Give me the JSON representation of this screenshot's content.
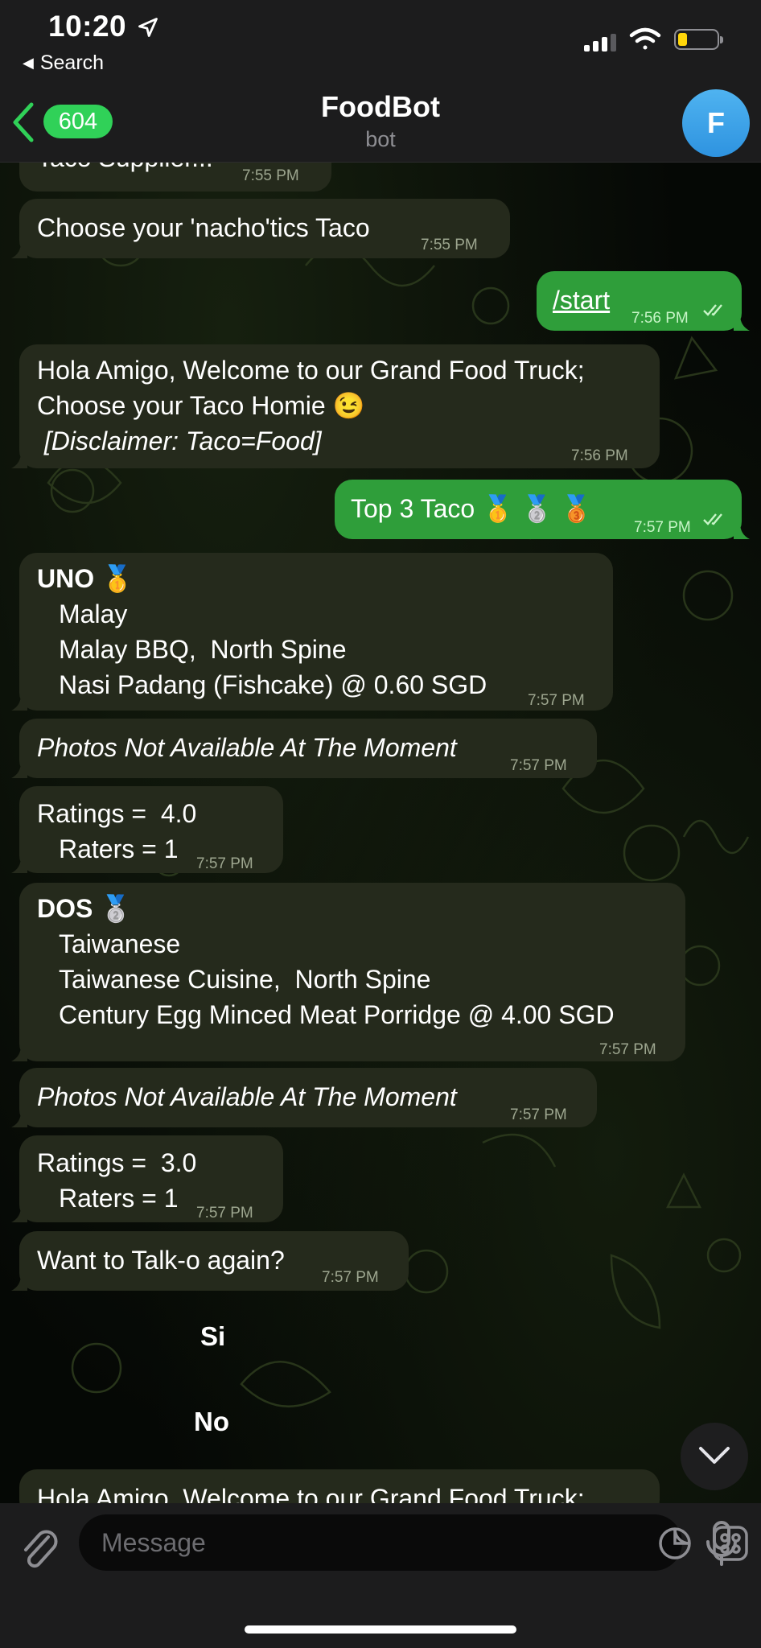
{
  "status_bar": {
    "time": "10:20",
    "back_label": "Search"
  },
  "header": {
    "back_count": "604",
    "title": "FoodBot",
    "subtitle": "bot",
    "avatar_letter": "F"
  },
  "messages": [
    {
      "lines": [
        "Taco Supplier..."
      ],
      "time": "7:55 PM"
    },
    {
      "lines": [
        "Choose your 'nacho'tics Taco"
      ],
      "time": "7:55 PM"
    },
    {
      "lines": [
        "/start"
      ],
      "time": "7:56 PM"
    },
    {
      "lines": [
        "Hola Amigo, Welcome to our Grand Food Truck;",
        "Choose your Taco Homie 😉",
        " [Disclaimer: Taco=Food]"
      ],
      "time": "7:56 PM"
    },
    {
      "lines": [
        "Top 3 Taco 🥇 🥈 🥉"
      ],
      "time": "7:57 PM"
    },
    {
      "lines": [
        "UNO 🥇",
        "Malay",
        "Malay BBQ,  North Spine",
        "Nasi Padang (Fishcake) @ 0.60 SGD"
      ],
      "time": "7:57 PM"
    },
    {
      "lines": [
        "Photos Not Available At The Moment"
      ],
      "time": "7:57 PM"
    },
    {
      "lines": [
        "Ratings =  4.0",
        "Raters = 1"
      ],
      "time": "7:57 PM"
    },
    {
      "lines": [
        "DOS 🥈",
        "Taiwanese",
        "Taiwanese Cuisine,  North Spine",
        "Century Egg Minced Meat Porridge @ 4.00 SGD"
      ],
      "time": "7:57 PM"
    },
    {
      "lines": [
        "Photos Not Available At The Moment"
      ],
      "time": "7:57 PM"
    },
    {
      "lines": [
        "Ratings =  3.0",
        "Raters = 1"
      ],
      "time": "7:57 PM"
    },
    {
      "lines": [
        "Want to Talk-o again?"
      ],
      "time": "7:57 PM"
    },
    {
      "lines": [
        "Hola Amigo, Welcome to our Grand Food Truck;"
      ]
    }
  ],
  "inline_buttons": [
    "Si",
    "No"
  ],
  "composer": {
    "placeholder": "Message"
  },
  "icons": {
    "location": "location-arrow-icon",
    "signal": "cellular-signal-icon",
    "wifi": "wifi-icon",
    "battery": "battery-icon",
    "back": "chevron-left-icon",
    "attach": "paperclip-icon",
    "sticker_toggle": "moon-icon",
    "keyboard": "bot-keyboard-icon",
    "mic": "microphone-icon",
    "scroll": "chevron-down-icon",
    "read": "double-check-icon"
  },
  "colors": {
    "outgoing": "#2f9e3a",
    "incoming": "#252a1c",
    "badge": "#30d158",
    "avatar": "#3aa3ea",
    "battery_low": "#ffd60a"
  }
}
